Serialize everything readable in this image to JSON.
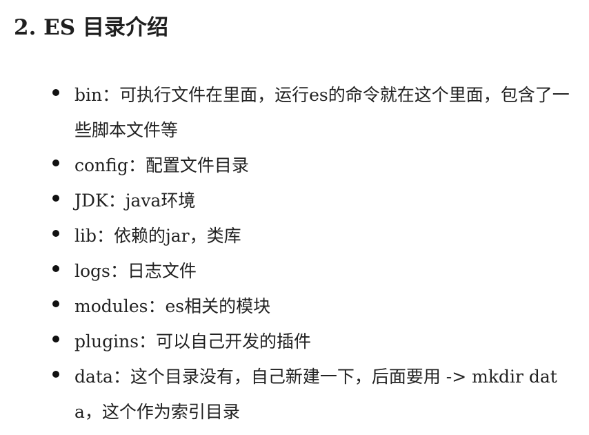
{
  "heading": "2. ES 目录介绍",
  "items": [
    {
      "text": "bin：可执行文件在里面，运行es的命令就在这个里面，包含了一些脚本文件等"
    },
    {
      "text": "config：配置文件目录"
    },
    {
      "text": "JDK：java环境"
    },
    {
      "text": "lib：依赖的jar，类库"
    },
    {
      "text": "logs：日志文件"
    },
    {
      "text": "modules：es相关的模块"
    },
    {
      "text": "plugins：可以自己开发的插件"
    },
    {
      "text": "data：这个目录没有，自己新建一下，后面要用 -> mkdir data，这个作为索引目录"
    }
  ]
}
